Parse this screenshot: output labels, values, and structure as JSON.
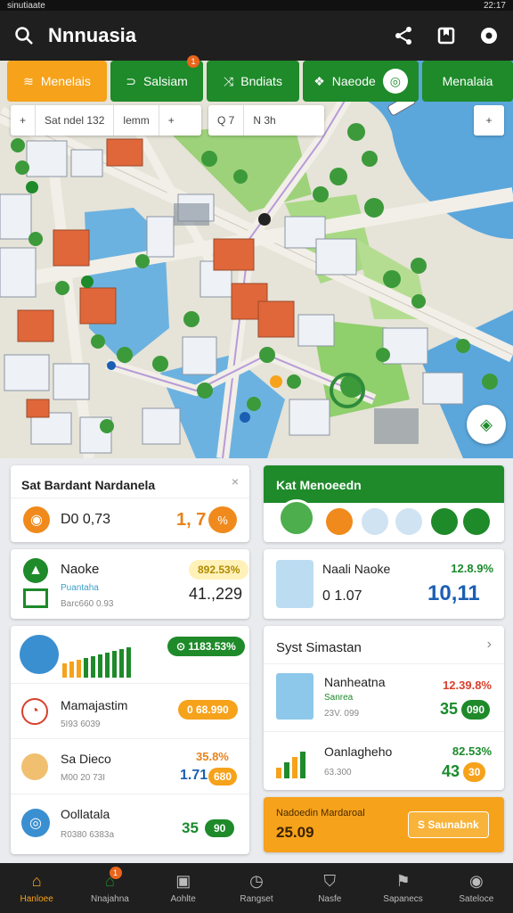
{
  "status": {
    "left": "sinutiaate",
    "right": "22:17"
  },
  "header": {
    "title": "Nnnuasia"
  },
  "tabs": [
    {
      "label": "Menelais"
    },
    {
      "label": "Salsiam"
    },
    {
      "label": "Bndiats"
    },
    {
      "label": "Naeode"
    },
    {
      "label": "Menalaia"
    }
  ],
  "tab_badge": "1",
  "map_toolbar_left": {
    "field1": "Sat ndel 132",
    "field2": "lemm"
  },
  "map_toolbar_mid": {
    "field1": "Q 7",
    "field2": "N 3h"
  },
  "card_left1": {
    "title": "Sat Bardant Nardanela",
    "value": "D0 0,73",
    "right_value": "1, 7",
    "right_pill": "%"
  },
  "card_left2": {
    "title": "Naoke",
    "sub1": "Puantaha",
    "sub2": "Barc660 0.93",
    "pill": "892.53%",
    "value": "41.,229"
  },
  "card_left3": {
    "chip": "1183.53%",
    "items": [
      {
        "title": "Mamajastim",
        "sub": "5I93 6039",
        "pill": "0 68.990"
      },
      {
        "title": "Sa Dieco",
        "sub": "M00 20 73I",
        "pct": "35.8%",
        "value": "1.71",
        "pill": "680"
      },
      {
        "title": "Oollatala",
        "sub": "R0380 6383a",
        "value": "35",
        "pill": "90"
      }
    ]
  },
  "card_right1": {
    "title": "Kat Menoeedn"
  },
  "card_right2": {
    "title": "Naali Naoke",
    "pct": "12.8.9%",
    "value": "0 1.07",
    "big": "10,11"
  },
  "card_right3": {
    "title": "Syst Simastan",
    "items": [
      {
        "title": "Nanheatna",
        "sub": "Sanrea",
        "sub2": "23V. 099",
        "pct": "12.39.8%",
        "value": "35",
        "pill": "090"
      },
      {
        "title": "Oanlagheho",
        "sub": "63.300",
        "pct": "82.53%",
        "value": "43",
        "pill": "30"
      }
    ]
  },
  "card_right4": {
    "title": "Nadoedin Mardaroal",
    "value": "25.09",
    "button": "S Saunabnk"
  },
  "nav": [
    {
      "label": "Hanloee"
    },
    {
      "label": "Nnajahna"
    },
    {
      "label": "Aohlte"
    },
    {
      "label": "Rangset"
    },
    {
      "label": "Nasfe"
    },
    {
      "label": "Sapanecs"
    },
    {
      "label": "Sateloce"
    }
  ],
  "nav_badge": "1",
  "colors": {
    "accent": "#f6a21b",
    "green": "#1e8a2a",
    "water": "#5ba7dc",
    "dark": "#1f1f1f"
  }
}
